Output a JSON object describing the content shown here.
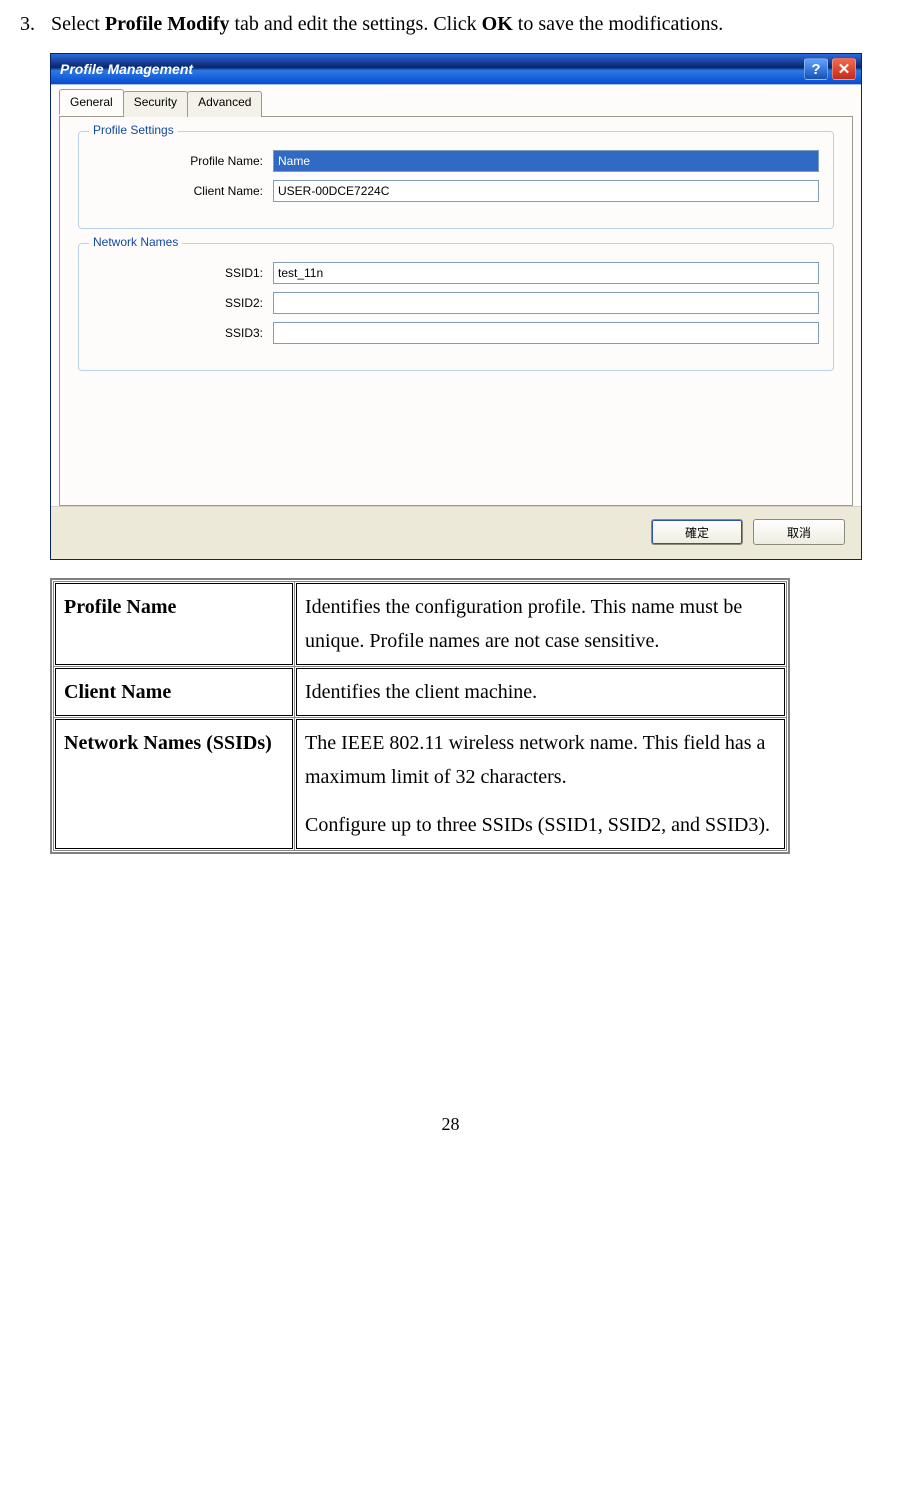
{
  "instruction": {
    "number": "3.",
    "prefix": "Select ",
    "bold1": "Profile Modify",
    "middle": " tab and edit the settings. Click ",
    "bold2": "OK",
    "suffix": " to save the modifications."
  },
  "window": {
    "title": "Profile Management",
    "help_glyph": "?",
    "close_glyph": "✕",
    "tabs": {
      "general": "General",
      "security": "Security",
      "advanced": "Advanced"
    },
    "profile_settings": {
      "legend": "Profile Settings",
      "profile_name_label": "Profile Name:",
      "profile_name_value": "Name",
      "client_name_label": "Client Name:",
      "client_name_value": "USER-00DCE7224C"
    },
    "network_names": {
      "legend": "Network Names",
      "ssid1_label": "SSID1:",
      "ssid1_value": "test_11n",
      "ssid2_label": "SSID2:",
      "ssid2_value": "",
      "ssid3_label": "SSID3:",
      "ssid3_value": ""
    },
    "buttons": {
      "ok": "確定",
      "cancel": "取消"
    }
  },
  "desc": {
    "r1": {
      "term": "Profile Name",
      "text": "Identifies the configuration profile. This name must be unique. Profile names are not case sensitive."
    },
    "r2": {
      "term": "Client Name",
      "text": "Identifies the client machine."
    },
    "r3": {
      "term": "Network Names (SSIDs)",
      "p1": "The IEEE 802.11 wireless network name. This field has a maximum limit of 32 characters.",
      "p2": "Configure up to three SSIDs (SSID1, SSID2, and SSID3)."
    }
  },
  "page_number": "28"
}
